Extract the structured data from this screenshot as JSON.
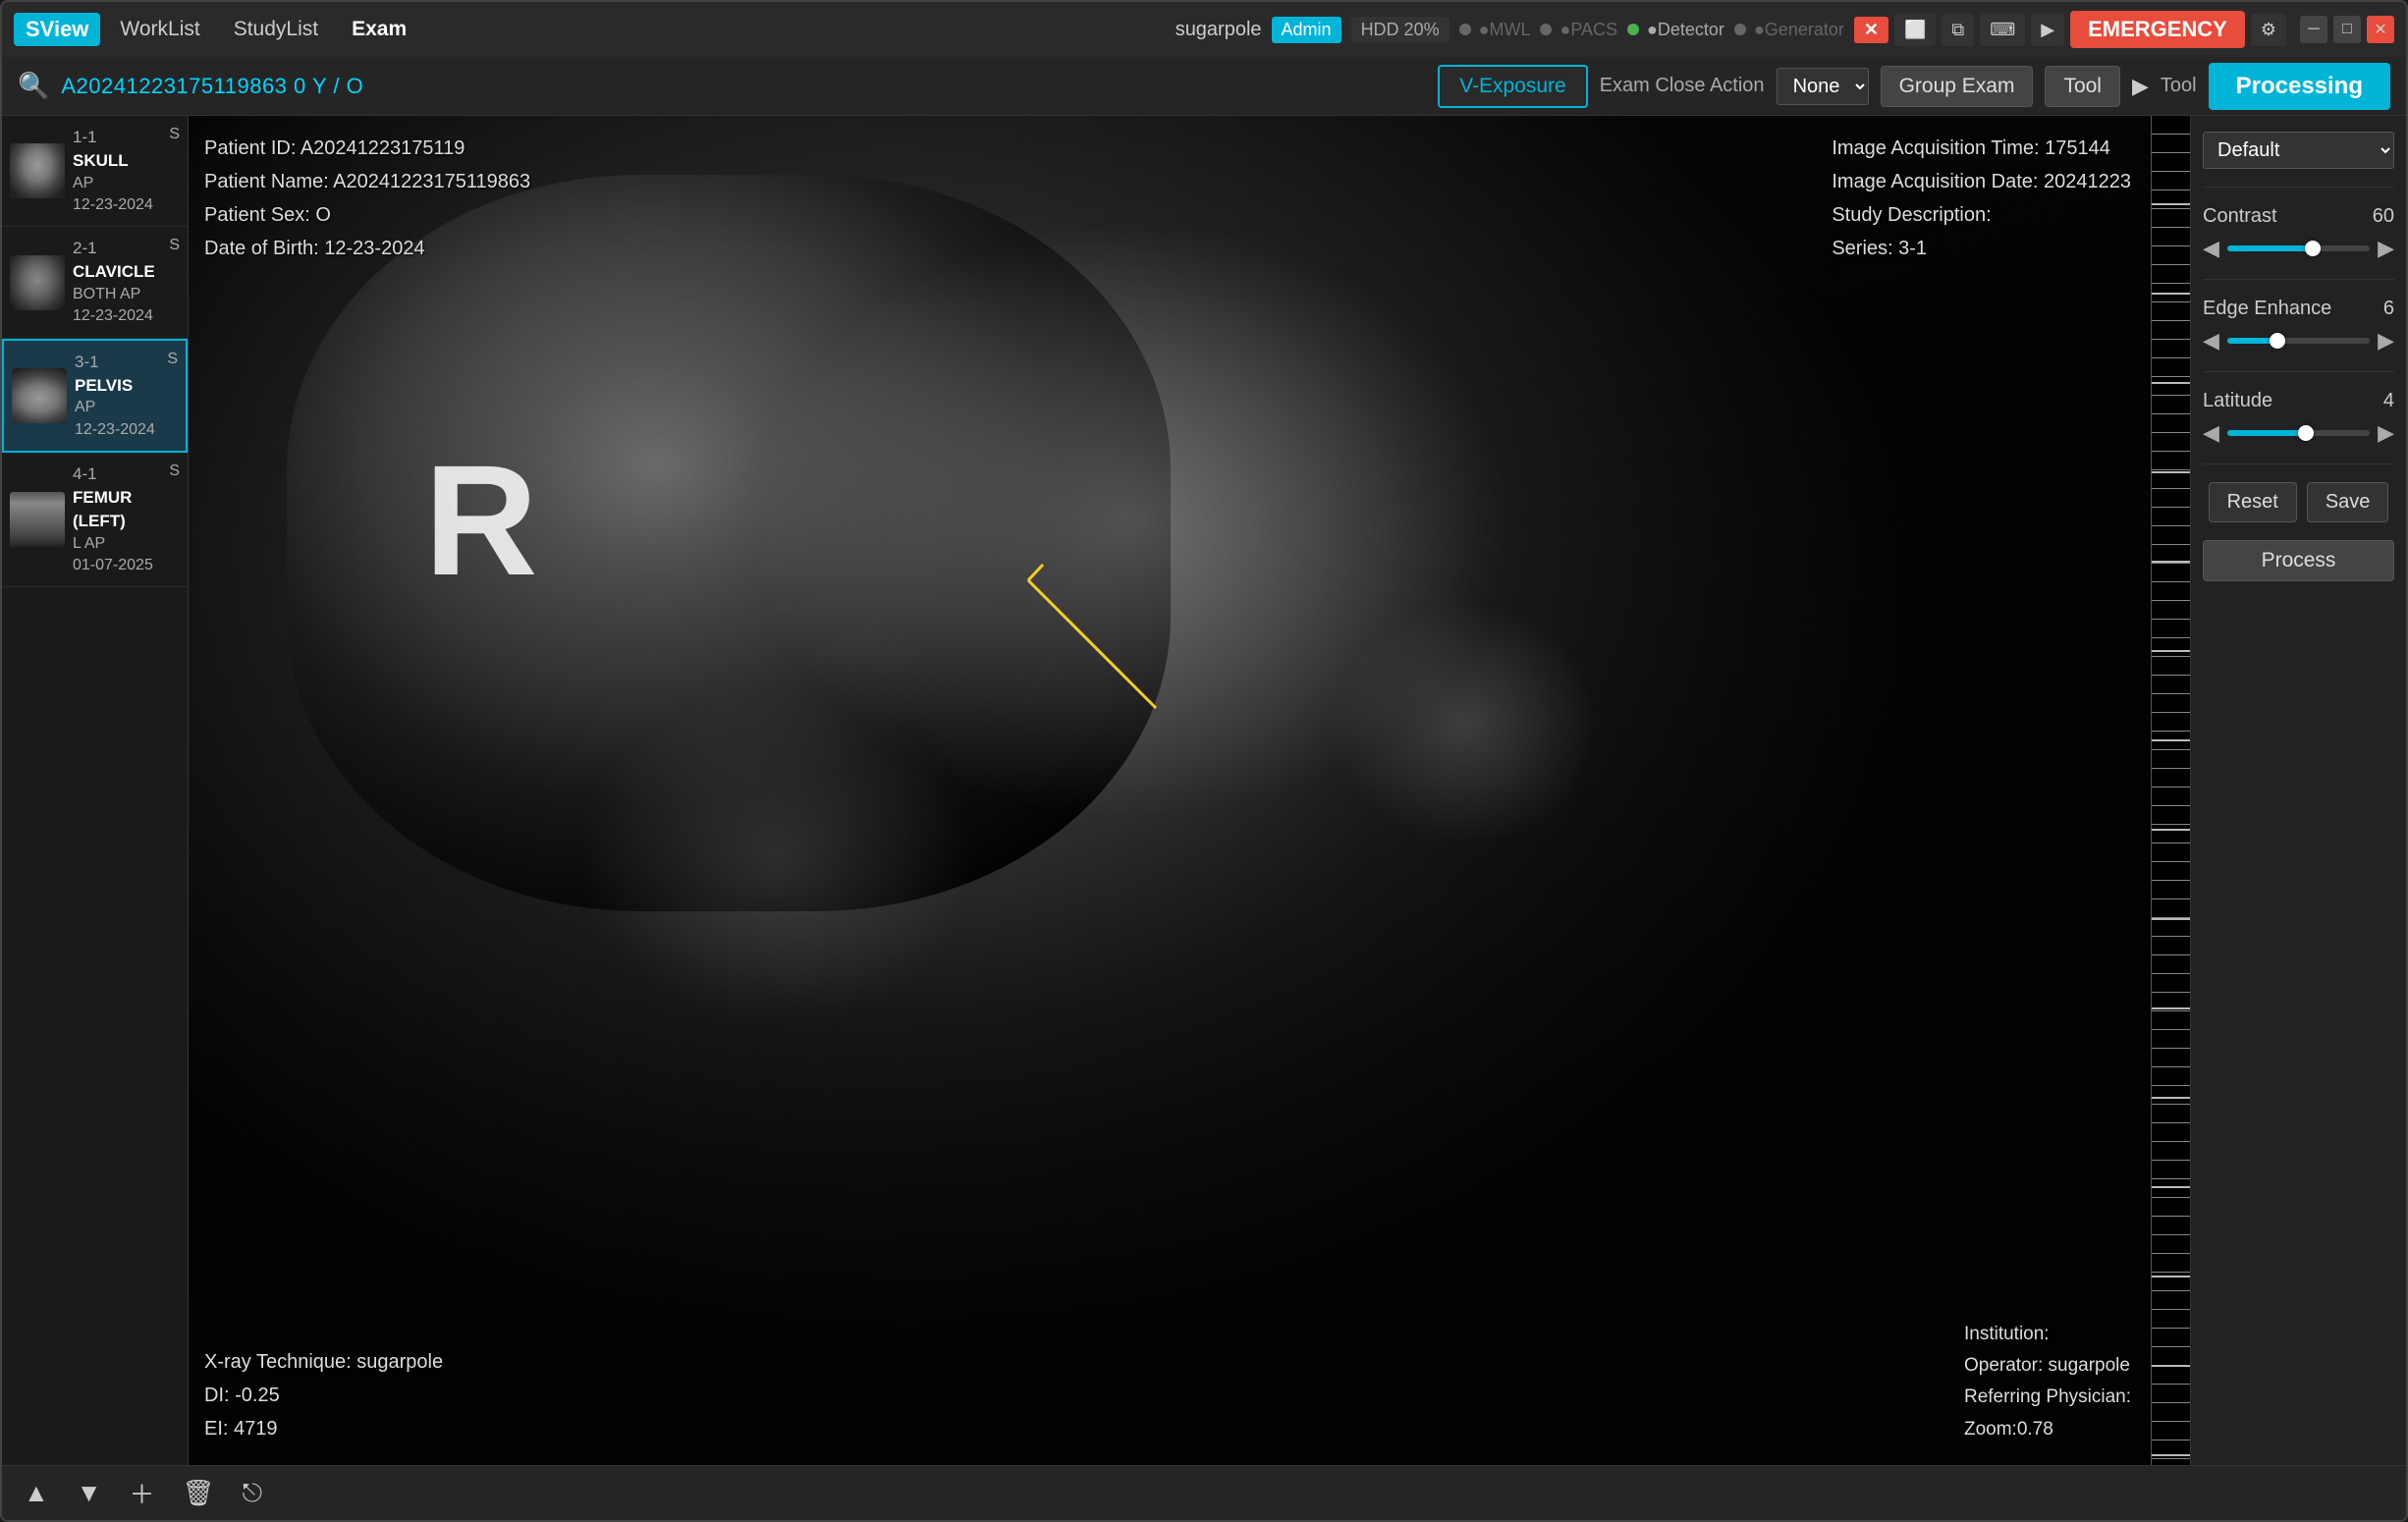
{
  "app": {
    "logo": "SView",
    "menu": [
      "WorkList",
      "StudyList",
      "Exam"
    ],
    "active_menu": "Exam"
  },
  "titlebar": {
    "user": "sugarpole",
    "admin_label": "Admin",
    "hdd_label": "HDD 20%",
    "mwl_label": "●MWL",
    "pacs_label": "●PACS",
    "detector_label": "●Detector",
    "generator_label": "●Generator",
    "emergency_label": "EMERGENCY",
    "close_x": "✕"
  },
  "toolbar": {
    "patient_id": "A20241223175119863  0 Y / O",
    "v_exposure": "V-Exposure",
    "exam_close_label": "Exam Close Action",
    "exam_close_value": "None",
    "group_exam": "Group Exam",
    "tool_label1": "Tool",
    "tool_label2": "Tool",
    "processing": "Processing"
  },
  "series": [
    {
      "num": "1-1",
      "body": "SKULL",
      "view": "AP",
      "date": "12-23-2024",
      "badge": "S",
      "type": "skull"
    },
    {
      "num": "2-1",
      "body": "CLAVICLE",
      "view": "BOTH AP",
      "date": "12-23-2024",
      "badge": "S",
      "type": "chest"
    },
    {
      "num": "3-1",
      "body": "PELVIS",
      "view": "AP",
      "date": "12-23-2024",
      "badge": "S",
      "type": "pelvis",
      "active": true
    },
    {
      "num": "4-1",
      "body": "FEMUR (LEFT)",
      "view": "L AP",
      "date": "01-07-2025",
      "badge": "S",
      "type": "femur"
    }
  ],
  "patient_overlay": {
    "patient_id": "Patient ID: A20241223175119",
    "patient_name": "Patient Name: A20241223175119863",
    "patient_sex": "Patient Sex: O",
    "dob": "Date of Birth: 12-23-2024"
  },
  "image_overlay": {
    "acquisition_time_label": "Image Acquisition Time:",
    "acquisition_time": "175144",
    "acquisition_date_label": "Image Acquisition Date:",
    "acquisition_date": "20241223",
    "study_desc_label": "Study Description:",
    "study_desc": "",
    "series_label": "Series:",
    "series": "3-1"
  },
  "bottom_left_overlay": {
    "xray_tech": "X-ray Technique: sugarpole",
    "di": "DI: -0.25",
    "ei": "EI: 4719"
  },
  "bottom_right_overlay": {
    "institution": "Institution:",
    "operator": "Operator: sugarpole",
    "referring": "Referring Physician:",
    "zoom": "Zoom:0.78"
  },
  "right_panel": {
    "preset": "Default",
    "contrast_label": "Contrast",
    "contrast_value": "60",
    "contrast_pct": 60,
    "edge_enhance_label": "Edge Enhance",
    "edge_enhance_value": "6",
    "edge_enhance_pct": 35,
    "latitude_label": "Latitude",
    "latitude_value": "4",
    "latitude_pct": 55,
    "reset_label": "Reset",
    "save_label": "Save",
    "process_label": "Process"
  }
}
